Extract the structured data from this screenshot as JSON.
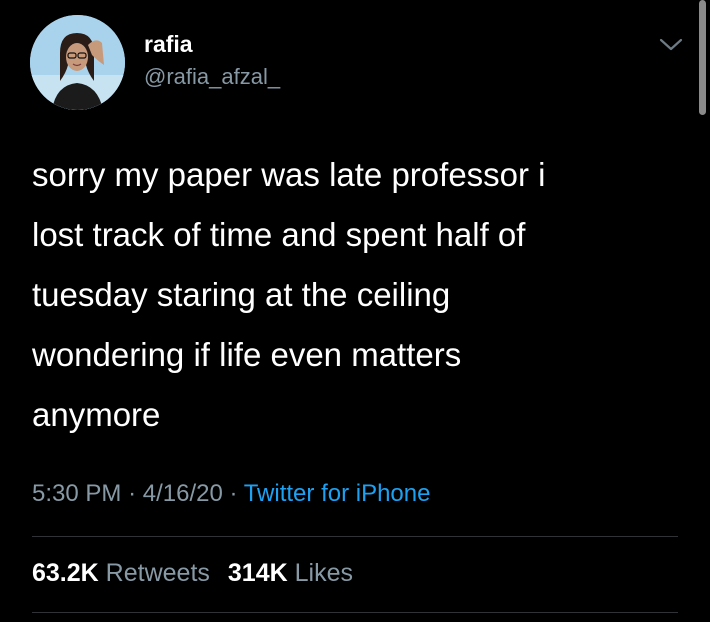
{
  "author": {
    "display_name": "rafia",
    "handle": "@rafia_afzal_"
  },
  "tweet": {
    "text": "sorry my paper was late professor i\nlost track of time and spent half of\ntuesday staring at the ceiling\nwondering if life even matters\nanymore"
  },
  "meta": {
    "time": "5:30 PM",
    "separator": "·",
    "date": "4/16/20",
    "source": "Twitter for iPhone"
  },
  "stats": {
    "retweets_count": "63.2K",
    "retweets_label": "Retweets",
    "likes_count": "314K",
    "likes_label": "Likes"
  },
  "icons": {
    "menu": "chevron-down-icon"
  },
  "colors": {
    "background": "#000000",
    "text": "#ffffff",
    "secondary": "#8899a6",
    "link": "#1da1f2",
    "divider": "#2f3336"
  }
}
